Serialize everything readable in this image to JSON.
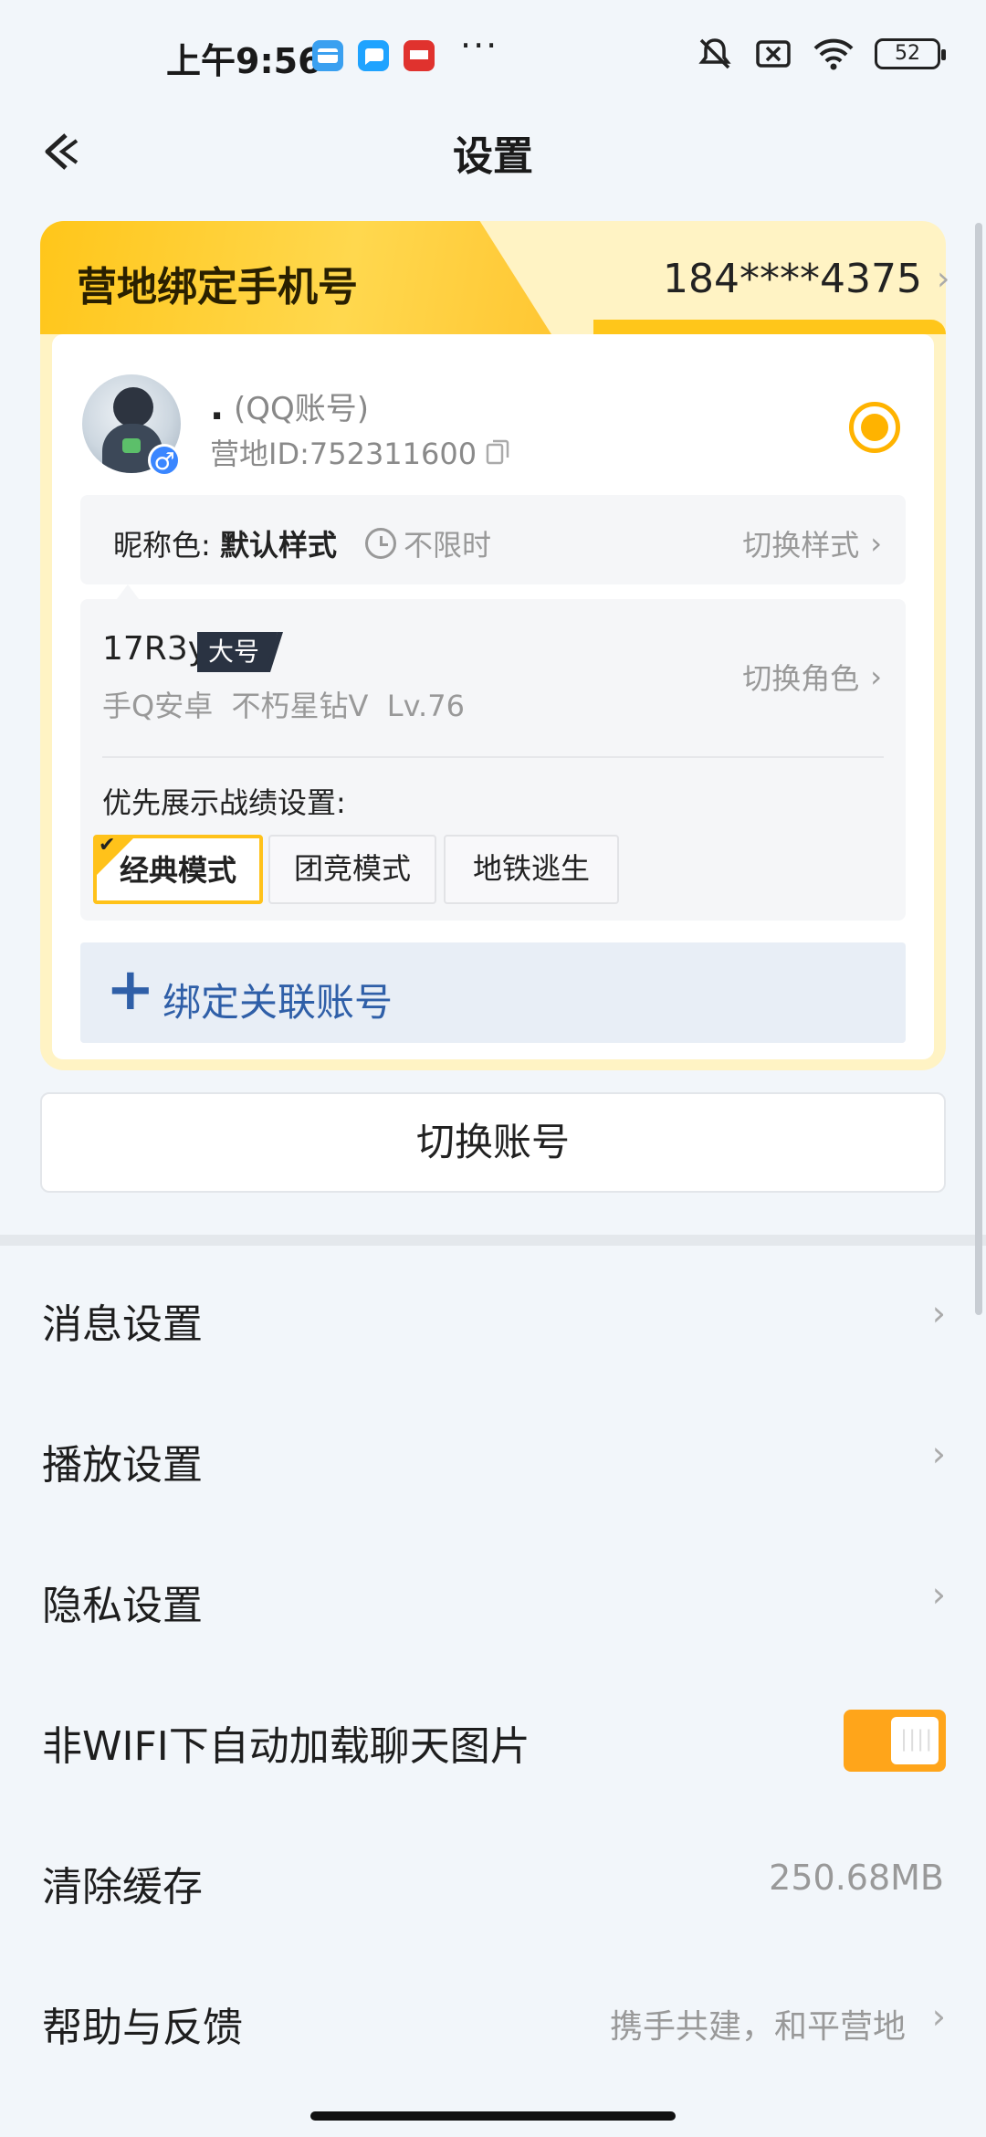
{
  "status_bar": {
    "time": "上午9:56",
    "battery": "52",
    "more": "···",
    "icons": [
      "wallet-icon",
      "chat-bubble-icon",
      "news-app-icon",
      "mute-icon",
      "no-sim-icon",
      "wifi-icon",
      "battery-icon"
    ]
  },
  "header": {
    "title": "设置",
    "back_icon": "back-arrow-icon"
  },
  "account_card": {
    "bind_phone_label": "营地绑定手机号",
    "bind_phone_value": "184****4375",
    "nickname": ".",
    "account_type": "(QQ账号)",
    "camp_id": "营地ID:752311600",
    "nickname_color_label": "昵称色:",
    "nickname_color_value": "默认样式",
    "duration": "不限时",
    "switch_style": "切换样式",
    "role_name": "17R3y",
    "role_badge": "大号",
    "role_info": "手Q安卓  不朽星钻V  Lv.76",
    "switch_role": "切换角色",
    "priority_label": "优先展示战绩设置:",
    "modes": [
      {
        "label": "经典模式",
        "active": true
      },
      {
        "label": "团竞模式",
        "active": false
      },
      {
        "label": "地铁逃生",
        "active": false
      }
    ],
    "bind_related": "绑定关联账号",
    "accent_color": "#ffc21a"
  },
  "switch_account": "切换账号",
  "settings": [
    {
      "label": "消息设置"
    },
    {
      "label": "播放设置"
    },
    {
      "label": "隐私设置"
    },
    {
      "label": "非WIFI下自动加载聊天图片",
      "toggle_on": true
    },
    {
      "label": "清除缓存",
      "value": "250.68MB"
    },
    {
      "label": "帮助与反馈",
      "value": "携手共建，和平营地"
    }
  ]
}
